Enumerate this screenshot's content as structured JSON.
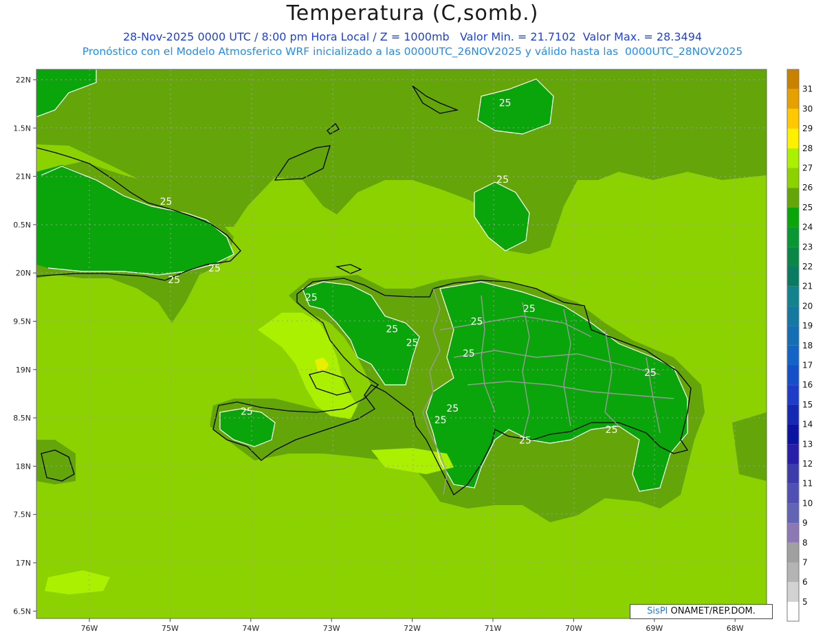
{
  "title": "Temperatura (C,somb.)",
  "subtitle": {
    "line1": "28-Nov-2025 0000 UTC / 8:00 pm Hora Local / Z = 1000mb   Valor Min. = 21.7102  Valor Max. = 28.3494",
    "line2": "Pronóstico con el Modelo Atmosferico WRF inicializado a las 0000UTC_26NOV2025 y válido hasta las  0000UTC_28NOV2025"
  },
  "credit": {
    "brand": "SisPI",
    "rest": " ONAMET/REP.DOM."
  },
  "colors": {
    "c23": "#0aa50a",
    "c24": "#0aa50a",
    "c25": "#64a50a",
    "c26": "#8cd200",
    "c27": "#aaf000",
    "c28": "#e6f000",
    "coast": "#000000",
    "border": "#9a9a9a",
    "contour": "#ffffff"
  },
  "chart_data": {
    "type": "heatmap",
    "variable": "Temperatura",
    "units": "C",
    "x_ticks": [
      "76W",
      "75W",
      "74W",
      "73W",
      "72W",
      "71W",
      "70W",
      "69W",
      "68W"
    ],
    "y_ticks": [
      "22N",
      "1.5N",
      "21N",
      "0.5N",
      "20N",
      "9.5N",
      "19N",
      "8.5N",
      "18N",
      "7.5N",
      "17N",
      "6.5N"
    ],
    "grid": true,
    "colorbar": {
      "position": "right",
      "levels": [
        31,
        30,
        29,
        28,
        27,
        26,
        25,
        24,
        23,
        22,
        21,
        20,
        19,
        18,
        17,
        16,
        15,
        14,
        13,
        12,
        11,
        10,
        9,
        8,
        7,
        6,
        5
      ],
      "colors": [
        "#c88200",
        "#e6a000",
        "#ffc800",
        "#fff000",
        "#aaf000",
        "#8cd200",
        "#64a50a",
        "#0aa50a",
        "#0a9632",
        "#0a8746",
        "#0a7a60",
        "#14828c",
        "#1478a0",
        "#146eb4",
        "#1464c8",
        "#1450c8",
        "#1e3cc8",
        "#1428b4",
        "#0a14a0",
        "#281eaa",
        "#3c3caa",
        "#5050b4",
        "#6464b4",
        "#8c78b4",
        "#a0a0a0",
        "#b4b4b4",
        "#d2d2d2"
      ],
      "bottom_color": "#ffffff"
    },
    "contour_labels": [
      {
        "lon": -75.05,
        "lat": 20.74,
        "text": "25"
      },
      {
        "lon": -74.45,
        "lat": 20.05,
        "text": "25"
      },
      {
        "lon": -74.95,
        "lat": 19.93,
        "text": "25"
      },
      {
        "lon": -73.25,
        "lat": 19.75,
        "text": "25"
      },
      {
        "lon": -72.25,
        "lat": 19.42,
        "text": "25"
      },
      {
        "lon": -72.0,
        "lat": 19.28,
        "text": "25"
      },
      {
        "lon": -71.2,
        "lat": 19.5,
        "text": "25"
      },
      {
        "lon": -71.3,
        "lat": 19.17,
        "text": "25"
      },
      {
        "lon": -70.55,
        "lat": 19.63,
        "text": "25"
      },
      {
        "lon": -69.05,
        "lat": 18.97,
        "text": "25"
      },
      {
        "lon": -74.05,
        "lat": 18.57,
        "text": "25"
      },
      {
        "lon": -71.5,
        "lat": 18.6,
        "text": "25"
      },
      {
        "lon": -71.65,
        "lat": 18.48,
        "text": "25"
      },
      {
        "lon": -70.6,
        "lat": 18.27,
        "text": "25"
      },
      {
        "lon": -69.53,
        "lat": 18.38,
        "text": "25"
      },
      {
        "lon": -70.85,
        "lat": 21.76,
        "text": "25"
      },
      {
        "lon": -70.88,
        "lat": 20.97,
        "text": "25"
      }
    ]
  }
}
